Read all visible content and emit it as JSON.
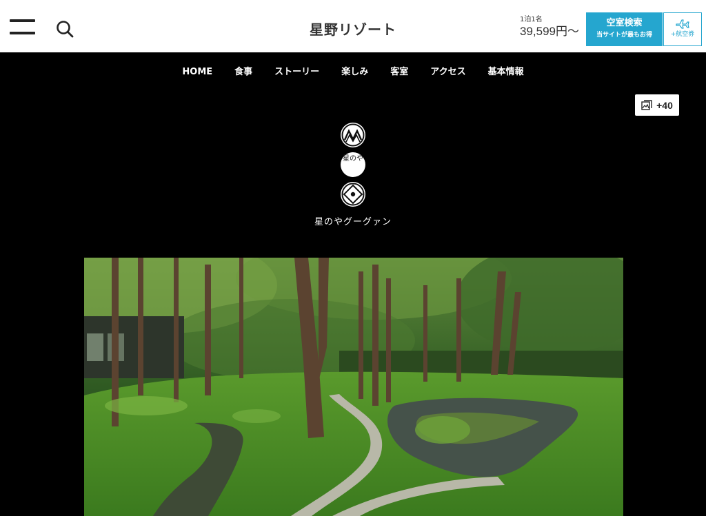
{
  "header": {
    "brand_logo": "星野リゾート",
    "price": {
      "caption": "1泊1名",
      "value": "39,599円〜"
    },
    "search_button": {
      "label": "空室検索",
      "sublabel": "当サイトが最もお得"
    },
    "flight_button": {
      "label": "+航空券",
      "icon": "airplane-icon"
    },
    "menu_icon": "hamburger-icon",
    "search_icon": "search-icon"
  },
  "nav": {
    "items": [
      "HOME",
      "食事",
      "ストーリー",
      "楽しみ",
      "客室",
      "アクセス",
      "基本情報"
    ]
  },
  "gallery": {
    "count": "+40",
    "icon": "gallery-icon"
  },
  "property": {
    "name": "星のやグーグァン",
    "emblem_text": "星のや"
  },
  "colors": {
    "accent": "#25a6cf",
    "background": "#000000",
    "header_bg": "#ffffff"
  }
}
